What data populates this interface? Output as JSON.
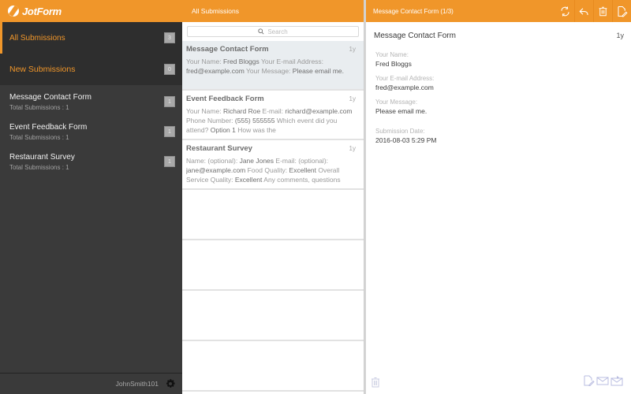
{
  "sidebar": {
    "brand": "JotForm",
    "all_submissions": {
      "label": "All Submissions",
      "count": "3"
    },
    "new_submissions": {
      "label": "New Submissions",
      "count": "0"
    },
    "forms": [
      {
        "name": "Message Contact Form",
        "subtitle": "Total Submissions : 1",
        "count": "1"
      },
      {
        "name": "Event Feedback Form",
        "subtitle": "Total Submissions : 1",
        "count": "1"
      },
      {
        "name": "Restaurant Survey",
        "subtitle": "Total Submissions : 1",
        "count": "1"
      }
    ],
    "footer": {
      "username": "JohnSmith101",
      "settings_icon": "gear-icon"
    }
  },
  "list": {
    "header_title": "All Submissions",
    "search_placeholder": "Search",
    "items": [
      {
        "title": "Message Contact Form",
        "age": "1y",
        "segments": [
          {
            "k": "Your Name: ",
            "v": "Fred Bloggs"
          },
          {
            "k": "  Your E-mail Address: ",
            "v": "fred@example.com"
          },
          {
            "k": "  Your Message: ",
            "v": "Please email me."
          }
        ],
        "selected": true
      },
      {
        "title": "Event Feedback Form",
        "age": "1y",
        "segments": [
          {
            "k": "Your Name: ",
            "v": "Richard Roe"
          },
          {
            "k": "  E-mail: ",
            "v": "richard@example.com"
          },
          {
            "k": "  Phone Number: ",
            "v": "(555) 555555"
          },
          {
            "k": " Which  event did you attend? ",
            "v": "Option 1"
          },
          {
            "k": "  How was the",
            "v": ""
          }
        ],
        "selected": false
      },
      {
        "title": "Restaurant Survey",
        "age": "1y",
        "segments": [
          {
            "k": "Name: (optional): ",
            "v": "Jane Jones"
          },
          {
            "k": "  E-mail:  (optional): ",
            "v": "jane@example.com"
          },
          {
            "k": "  Food Quality: ",
            "v": "Excellent"
          },
          {
            "k": "  Overall Service Quality: ",
            "v": "Excellent"
          },
          {
            "k": "  Any comments, questions",
            "v": ""
          }
        ],
        "selected": false
      }
    ]
  },
  "detail": {
    "header_title": "Message Contact Form (1/3)",
    "toolbar": [
      {
        "name": "refresh-button",
        "icon": "refresh-icon"
      },
      {
        "name": "reply-button",
        "icon": "reply-icon"
      },
      {
        "name": "delete-button",
        "icon": "trash-icon"
      },
      {
        "name": "edit-button",
        "icon": "edit-document-icon"
      }
    ],
    "form_title": "Message Contact Form",
    "age": "1y",
    "fields": [
      {
        "label": "Your Name:",
        "value": "Fred Bloggs"
      },
      {
        "label": "Your E-mail Address:",
        "value": "fred@example.com"
      },
      {
        "label": "Your Message:",
        "value": "Please email me."
      }
    ],
    "submission_date": {
      "label": "Submission Date:",
      "value": "2016-08-03 5:29 PM"
    },
    "footer_icons": [
      "trash-icon",
      "edit-document-icon",
      "email-icon",
      "email-send-icon"
    ]
  },
  "colors": {
    "accent": "#f0962a",
    "sidebar_bg": "#3a3a3a",
    "selected_row": "#e9edf0"
  }
}
